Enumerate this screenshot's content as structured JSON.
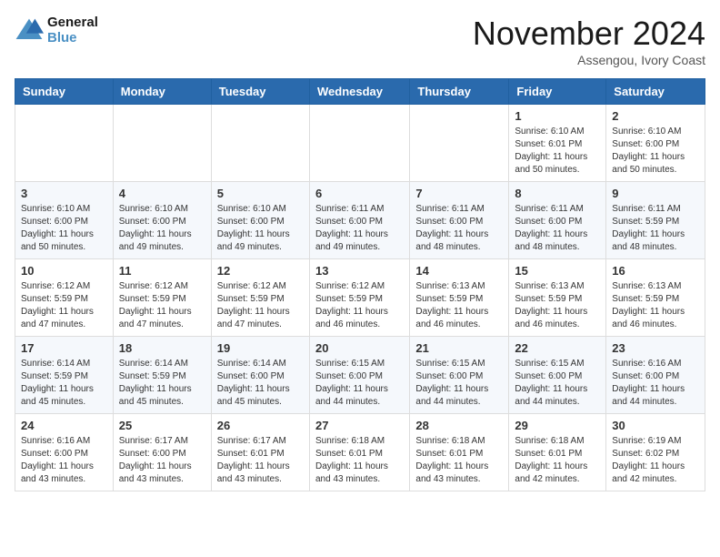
{
  "logo": {
    "line1": "General",
    "line2": "Blue"
  },
  "title": "November 2024",
  "location": "Assengou, Ivory Coast",
  "weekdays": [
    "Sunday",
    "Monday",
    "Tuesday",
    "Wednesday",
    "Thursday",
    "Friday",
    "Saturday"
  ],
  "weeks": [
    [
      {
        "day": "",
        "info": ""
      },
      {
        "day": "",
        "info": ""
      },
      {
        "day": "",
        "info": ""
      },
      {
        "day": "",
        "info": ""
      },
      {
        "day": "",
        "info": ""
      },
      {
        "day": "1",
        "info": "Sunrise: 6:10 AM\nSunset: 6:01 PM\nDaylight: 11 hours\nand 50 minutes."
      },
      {
        "day": "2",
        "info": "Sunrise: 6:10 AM\nSunset: 6:00 PM\nDaylight: 11 hours\nand 50 minutes."
      }
    ],
    [
      {
        "day": "3",
        "info": "Sunrise: 6:10 AM\nSunset: 6:00 PM\nDaylight: 11 hours\nand 50 minutes."
      },
      {
        "day": "4",
        "info": "Sunrise: 6:10 AM\nSunset: 6:00 PM\nDaylight: 11 hours\nand 49 minutes."
      },
      {
        "day": "5",
        "info": "Sunrise: 6:10 AM\nSunset: 6:00 PM\nDaylight: 11 hours\nand 49 minutes."
      },
      {
        "day": "6",
        "info": "Sunrise: 6:11 AM\nSunset: 6:00 PM\nDaylight: 11 hours\nand 49 minutes."
      },
      {
        "day": "7",
        "info": "Sunrise: 6:11 AM\nSunset: 6:00 PM\nDaylight: 11 hours\nand 48 minutes."
      },
      {
        "day": "8",
        "info": "Sunrise: 6:11 AM\nSunset: 6:00 PM\nDaylight: 11 hours\nand 48 minutes."
      },
      {
        "day": "9",
        "info": "Sunrise: 6:11 AM\nSunset: 5:59 PM\nDaylight: 11 hours\nand 48 minutes."
      }
    ],
    [
      {
        "day": "10",
        "info": "Sunrise: 6:12 AM\nSunset: 5:59 PM\nDaylight: 11 hours\nand 47 minutes."
      },
      {
        "day": "11",
        "info": "Sunrise: 6:12 AM\nSunset: 5:59 PM\nDaylight: 11 hours\nand 47 minutes."
      },
      {
        "day": "12",
        "info": "Sunrise: 6:12 AM\nSunset: 5:59 PM\nDaylight: 11 hours\nand 47 minutes."
      },
      {
        "day": "13",
        "info": "Sunrise: 6:12 AM\nSunset: 5:59 PM\nDaylight: 11 hours\nand 46 minutes."
      },
      {
        "day": "14",
        "info": "Sunrise: 6:13 AM\nSunset: 5:59 PM\nDaylight: 11 hours\nand 46 minutes."
      },
      {
        "day": "15",
        "info": "Sunrise: 6:13 AM\nSunset: 5:59 PM\nDaylight: 11 hours\nand 46 minutes."
      },
      {
        "day": "16",
        "info": "Sunrise: 6:13 AM\nSunset: 5:59 PM\nDaylight: 11 hours\nand 46 minutes."
      }
    ],
    [
      {
        "day": "17",
        "info": "Sunrise: 6:14 AM\nSunset: 5:59 PM\nDaylight: 11 hours\nand 45 minutes."
      },
      {
        "day": "18",
        "info": "Sunrise: 6:14 AM\nSunset: 5:59 PM\nDaylight: 11 hours\nand 45 minutes."
      },
      {
        "day": "19",
        "info": "Sunrise: 6:14 AM\nSunset: 6:00 PM\nDaylight: 11 hours\nand 45 minutes."
      },
      {
        "day": "20",
        "info": "Sunrise: 6:15 AM\nSunset: 6:00 PM\nDaylight: 11 hours\nand 44 minutes."
      },
      {
        "day": "21",
        "info": "Sunrise: 6:15 AM\nSunset: 6:00 PM\nDaylight: 11 hours\nand 44 minutes."
      },
      {
        "day": "22",
        "info": "Sunrise: 6:15 AM\nSunset: 6:00 PM\nDaylight: 11 hours\nand 44 minutes."
      },
      {
        "day": "23",
        "info": "Sunrise: 6:16 AM\nSunset: 6:00 PM\nDaylight: 11 hours\nand 44 minutes."
      }
    ],
    [
      {
        "day": "24",
        "info": "Sunrise: 6:16 AM\nSunset: 6:00 PM\nDaylight: 11 hours\nand 43 minutes."
      },
      {
        "day": "25",
        "info": "Sunrise: 6:17 AM\nSunset: 6:00 PM\nDaylight: 11 hours\nand 43 minutes."
      },
      {
        "day": "26",
        "info": "Sunrise: 6:17 AM\nSunset: 6:01 PM\nDaylight: 11 hours\nand 43 minutes."
      },
      {
        "day": "27",
        "info": "Sunrise: 6:18 AM\nSunset: 6:01 PM\nDaylight: 11 hours\nand 43 minutes."
      },
      {
        "day": "28",
        "info": "Sunrise: 6:18 AM\nSunset: 6:01 PM\nDaylight: 11 hours\nand 43 minutes."
      },
      {
        "day": "29",
        "info": "Sunrise: 6:18 AM\nSunset: 6:01 PM\nDaylight: 11 hours\nand 42 minutes."
      },
      {
        "day": "30",
        "info": "Sunrise: 6:19 AM\nSunset: 6:02 PM\nDaylight: 11 hours\nand 42 minutes."
      }
    ]
  ]
}
